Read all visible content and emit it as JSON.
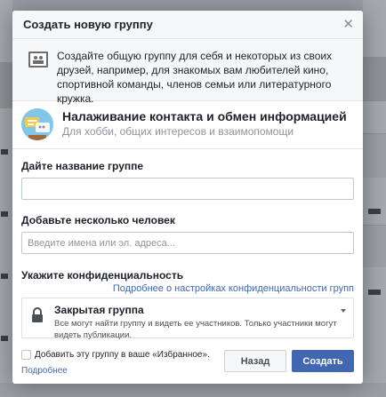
{
  "dialog": {
    "title": "Создать новую группу",
    "info_text": "Создайте общую группу для себя и некоторых из своих друзей, например, для знакомых вам любителей кино, спортивной команды, членов семьи или литературного кружка.",
    "purpose": {
      "title": "Налаживание контакта и обмен информацией",
      "subtitle": "Для хобби, общих интересов и взаимопомощи"
    },
    "name_field": {
      "label": "Дайте название группе",
      "value": "",
      "placeholder": ""
    },
    "members_field": {
      "label": "Добавьте несколько человек",
      "value": "",
      "placeholder": "Введите имена или эл. адреса..."
    },
    "privacy": {
      "label": "Укажите конфиденциальность",
      "more_link": "Подробнее о настройках конфиденциальности групп",
      "selected_name": "Закрытая группа",
      "selected_desc": "Все могут найти группу и видеть ее участников. Только участники могут видеть публикации."
    },
    "footer": {
      "favorites_label": "Добавить эту группу в ваше «Избранное».",
      "favorites_checked": false,
      "more_link": "Подробнее",
      "back_button": "Назад",
      "create_button": "Создать"
    }
  },
  "colors": {
    "accent": "#4267b2",
    "overlay": "#9a9da3",
    "header_bg": "#f6f7f9"
  },
  "icons": {
    "close": "close-icon",
    "info": "group-info-icon",
    "purpose": "group-purpose-icon",
    "lock": "lock-icon",
    "dropdown": "chevron-down-icon"
  }
}
